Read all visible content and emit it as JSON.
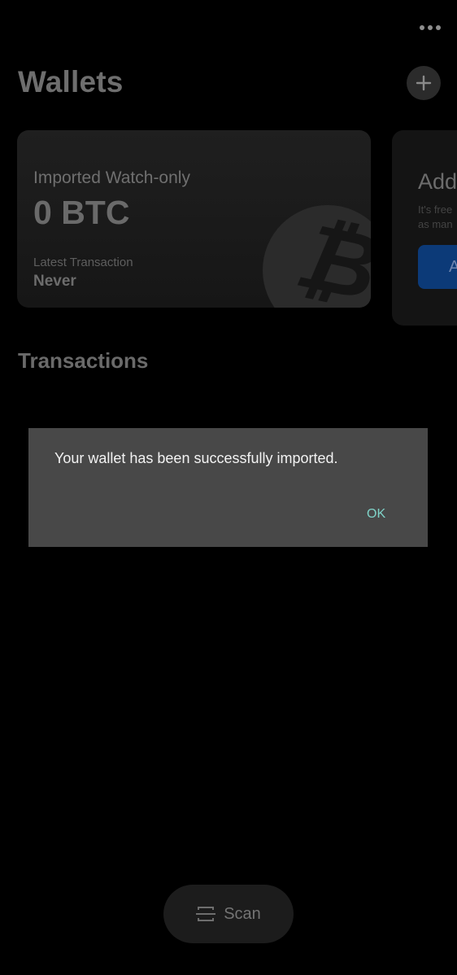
{
  "header": {
    "title": "Wallets",
    "more_icon": "more-horizontal-icon",
    "add_icon": "plus-icon"
  },
  "wallet_card": {
    "type_label": "Imported Watch-only",
    "balance": "0 BTC",
    "latest_label": "Latest Transaction",
    "latest_value": "Never",
    "icon": "bitcoin-icon"
  },
  "add_card": {
    "title": "Add",
    "description": "It's free\nas man",
    "button_label": "A"
  },
  "transactions": {
    "title": "Transactions"
  },
  "scan": {
    "label": "Scan",
    "icon": "scan-icon"
  },
  "dialog": {
    "message": "Your wallet has been successfully imported.",
    "ok_label": "OK"
  },
  "colors": {
    "background": "#000000",
    "dialog_bg": "#484848",
    "accent_ok": "#7fd3c8",
    "add_button": "#0c3a78"
  }
}
